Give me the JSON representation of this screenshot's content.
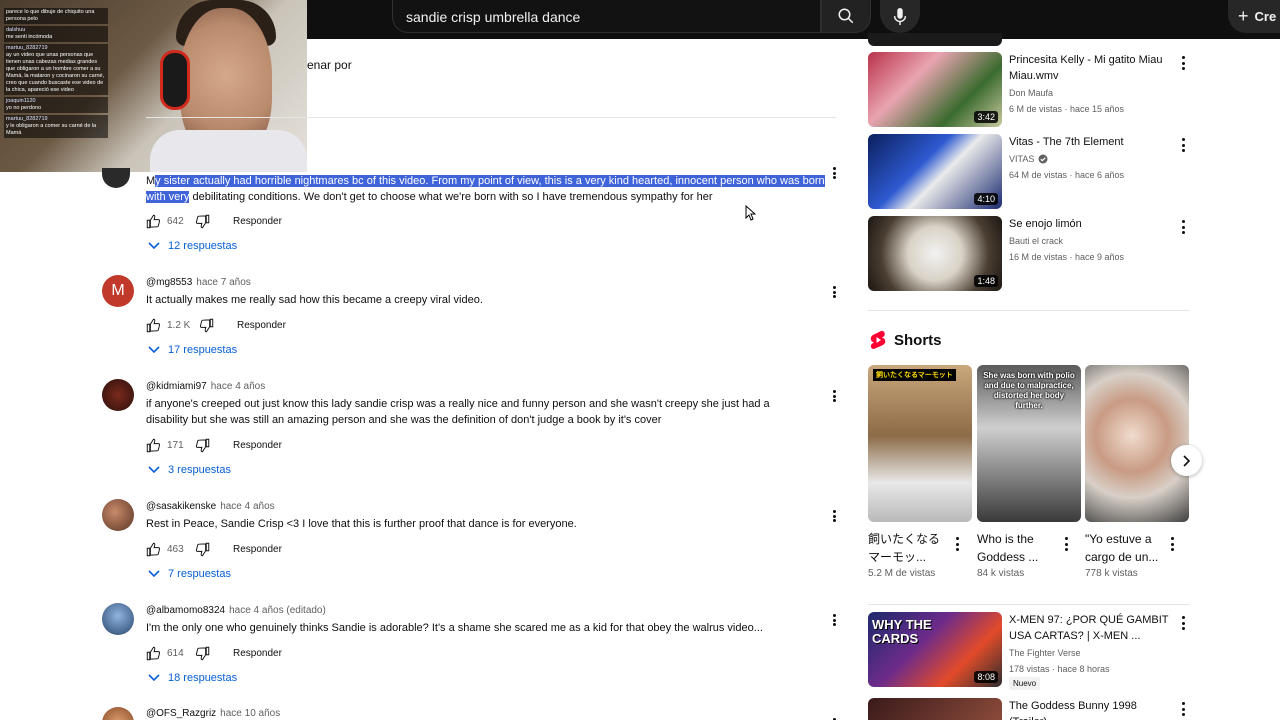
{
  "topbar": {
    "search_value": "sandie crisp umbrella dance",
    "create_label": "Cre"
  },
  "webcam": {
    "chat": [
      {
        "user": "",
        "text": "parece lo que dibuje de chiquito una persona pelo"
      },
      {
        "user": "dalshuu",
        "text": "me senti incómoda"
      },
      {
        "user": "martuu_8282719",
        "text": "ay un video que unas personas que tienen unas cabezas medias grandes que obligaron a un hombre comer a su Mamá, la mataron y cocinaron su carné, creo que cuando buscaste ese video de la chica, apareció ese video"
      },
      {
        "user": "joaquin1120",
        "text": "yo no perdono"
      },
      {
        "user": "martuu_8282719",
        "text": "y le obligaron a comer su carné de la Mamá"
      }
    ]
  },
  "sort_label": "enar por",
  "comments": [
    {
      "handle": "",
      "time": "",
      "text_highlight": "y sister actually had horrible nightmares bc of this video. From my point of view, this is a very kind hearted, innocent person who was born with very",
      "text_first": "M",
      "text_rest": " debilitating conditions. We don't get to choose what we're born with so I have tremendous sympathy for her",
      "likes": "642",
      "reply_label": "Responder",
      "replies": "12 respuestas"
    },
    {
      "handle": "@mg8553",
      "time": "hace 7 años",
      "avatar_letter": "M",
      "text": "It actually makes me really sad how this became a creepy viral video.",
      "likes": "1.2 K",
      "reply_label": "Responder",
      "replies": "17 respuestas"
    },
    {
      "handle": "@kidmiami97",
      "time": "hace 4 años",
      "text": "if anyone's creeped out just know this lady sandie crisp was a really nice and funny person and she wasn't creepy she just had a disability but she was still an amazing person and she was the definition of don't judge a book by it's cover",
      "likes": "171",
      "reply_label": "Responder",
      "replies": "3 respuestas"
    },
    {
      "handle": "@sasakikenske",
      "time": "hace 4 años",
      "text": "Rest in Peace, Sandie Crisp <3 I love that this is further proof that dance is for everyone.",
      "likes": "463",
      "reply_label": "Responder",
      "replies": "7 respuestas"
    },
    {
      "handle": "@albamomo8324",
      "time": "hace 4 años (editado)",
      "text": "I'm the only one who genuinely thinks Sandie is adorable? It's a shame she scared me as a kid for that obey the walrus video...",
      "likes": "614",
      "reply_label": "Responder",
      "replies": "18 respuestas"
    },
    {
      "handle": "@OFS_Razgriz",
      "time": "hace 10 años"
    }
  ],
  "related": [
    {
      "title": "Princesita Kelly - Mi gatito Miau Miau.wmv",
      "channel": "Don Maufa",
      "meta": "6 M de vistas · hace 15 años",
      "duration": "3:42"
    },
    {
      "title": "Vitas - The 7th Element",
      "channel": "VITAS",
      "meta": "64 M de vistas · hace 6 años",
      "duration": "4:10"
    },
    {
      "title": "Se enojo limón",
      "channel": "Bauti el crack",
      "meta": "16 M de vistas · hace 9 años",
      "duration": "1:48"
    }
  ],
  "shorts": {
    "heading": "Shorts",
    "items": [
      {
        "title": "飼いたくなるマーモッ...",
        "views": "5.2 M de vistas",
        "overlay": "飼いたくなるマーモット"
      },
      {
        "title": "Who is the Goddess ...",
        "views": "84 k vistas",
        "overlay": "She was born with polio and due to malpractice, distorted her body further."
      },
      {
        "title": "\"Yo estuve a cargo de un...",
        "views": "778 k vistas",
        "overlay": ""
      }
    ]
  },
  "related2": [
    {
      "title": "X-MEN 97: ¿POR QUÉ GAMBIT USA CARTAS? | X-MEN ...",
      "channel": "The Fighter Verse",
      "meta": "178 vistas · hace 8 horas",
      "duration": "8:08",
      "badge": "Nuevo",
      "thumb_text": "WHY THE CARDS"
    },
    {
      "title": "The Goddess Bunny 1998 (Trailer)",
      "channel": "",
      "meta": "",
      "duration": ""
    }
  ],
  "icons": {
    "search": "search-icon",
    "mic": "mic-icon",
    "like": "thumbs-up-icon",
    "dislike": "thumbs-down-icon",
    "more": "more-vert-icon",
    "shorts": "shorts-logo-icon",
    "next": "chevron-right-icon",
    "verified": "verified-icon"
  },
  "colors": {
    "link_blue": "#065fd4",
    "highlight": "#3f63d8",
    "shorts_red": "#ff0033"
  }
}
